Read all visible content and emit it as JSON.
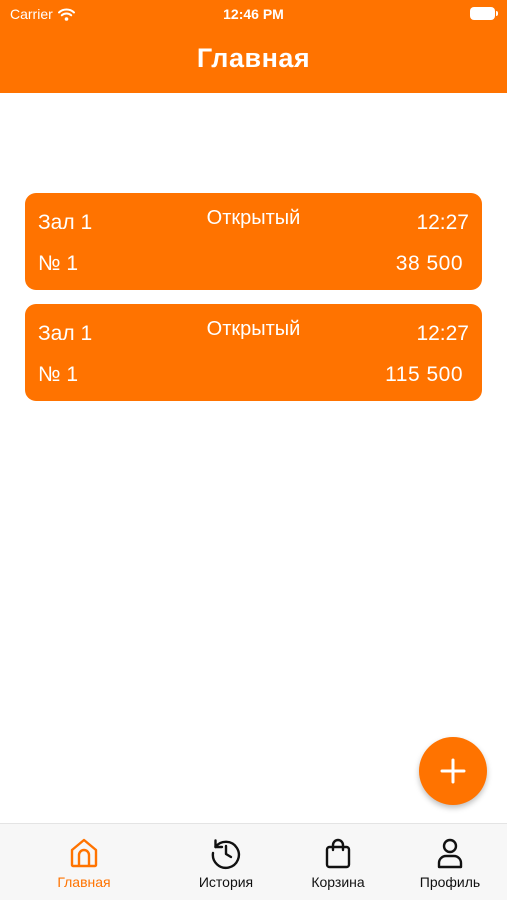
{
  "status_bar": {
    "carrier": "Carrier",
    "time": "12:46 PM"
  },
  "header": {
    "title": "Главная"
  },
  "orders": [
    {
      "hall": "Зал 1",
      "status": "Открытый",
      "time": "12:27",
      "number": "№ 1",
      "amount": "38 500"
    },
    {
      "hall": "Зал 1",
      "status": "Открытый",
      "time": "12:27",
      "number": "№ 1",
      "amount": "115 500"
    }
  ],
  "fab": {
    "icon": "plus-icon"
  },
  "tabbar": {
    "items": [
      {
        "label": "Главная",
        "icon": "home-icon",
        "active": true
      },
      {
        "label": "История",
        "icon": "history-icon",
        "active": false
      },
      {
        "label": "Корзина",
        "icon": "shopping-bag-icon",
        "active": false
      },
      {
        "label": "Профиль",
        "icon": "user-icon",
        "active": false
      }
    ]
  },
  "colors": {
    "accent": "#FF7300",
    "tab_inactive": "#111111",
    "tabbar_bg": "#F7F7F7"
  }
}
